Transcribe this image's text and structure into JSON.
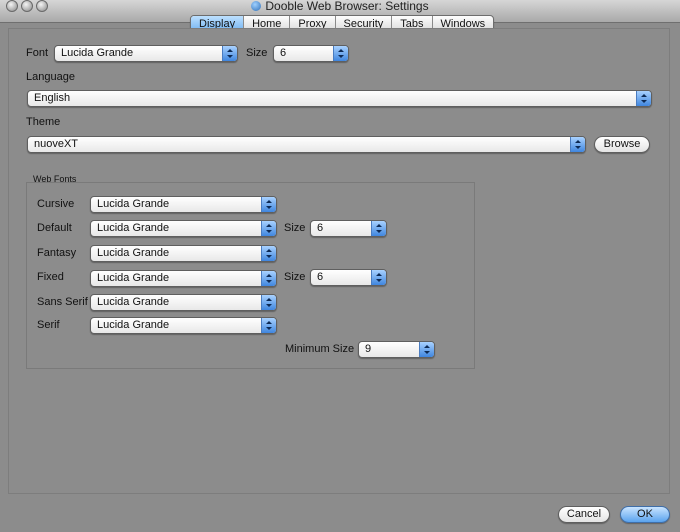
{
  "window": {
    "title": "Dooble Web Browser: Settings"
  },
  "tabs": [
    "Display",
    "Home",
    "Proxy",
    "Security",
    "Tabs",
    "Windows"
  ],
  "display": {
    "font_label": "Font",
    "font_value": "Lucida Grande",
    "size_label": "Size",
    "size_value": "6",
    "language_label": "Language",
    "language_value": "English",
    "theme_label": "Theme",
    "theme_value": "nuoveXT",
    "browse_label": "Browse"
  },
  "web_fonts": {
    "title": "Web Fonts",
    "rows": [
      {
        "label": "Cursive",
        "value": "Lucida Grande"
      },
      {
        "label": "Default",
        "value": "Lucida Grande",
        "size_label": "Size",
        "size_value": "6"
      },
      {
        "label": "Fantasy",
        "value": "Lucida Grande"
      },
      {
        "label": "Fixed",
        "value": "Lucida Grande",
        "size_label": "Size",
        "size_value": "6"
      },
      {
        "label": "Sans Serif",
        "value": "Lucida Grande"
      },
      {
        "label": "Serif",
        "value": "Lucida Grande"
      }
    ],
    "minimum_size_label": "Minimum Size",
    "minimum_size_value": "9"
  },
  "buttons": {
    "cancel": "Cancel",
    "ok": "OK"
  },
  "colors": {
    "window_bg": "#8c8c8c",
    "accent": "#5aa3ee",
    "active_tab": "#6fb1f0"
  },
  "icons": {
    "title": "dooble-globe-icon",
    "popup_arrow": "updown-chevron-icon"
  }
}
